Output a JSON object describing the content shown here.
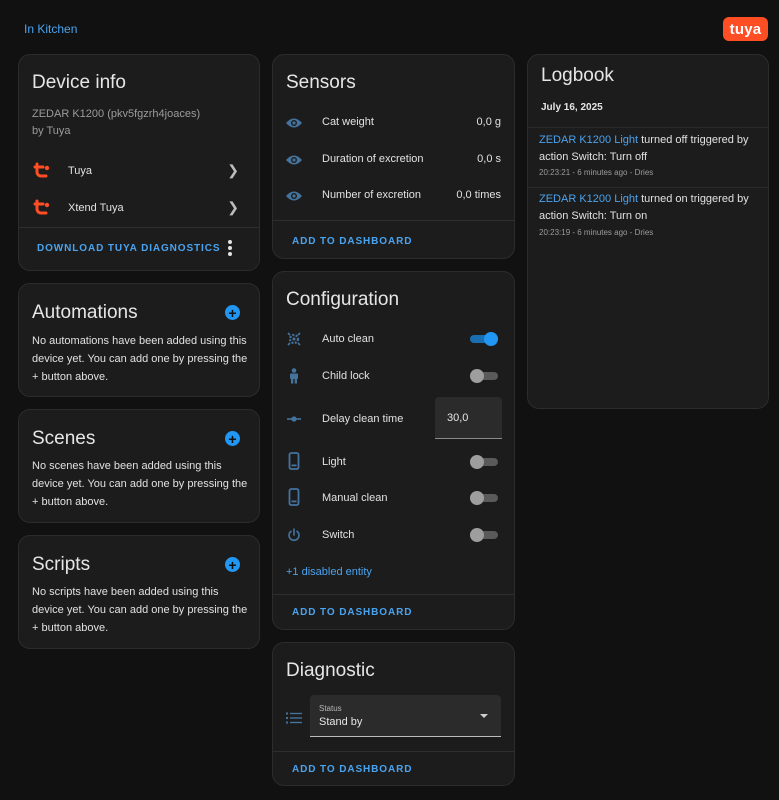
{
  "breadcrumb": {
    "area": "In Kitchen"
  },
  "logo": {
    "text": "tuya",
    "color": "#ff4d24"
  },
  "device_info": {
    "title": "Device info",
    "model": "ZEDAR K1200 (pkv5fgzrh4joaces)",
    "manufacturer": "by Tuya",
    "integrations": [
      {
        "label": "Tuya",
        "icon": "tuya-icon"
      },
      {
        "label": "Xtend Tuya",
        "icon": "tuya-icon"
      }
    ],
    "download_label": "DOWNLOAD TUYA DIAGNOSTICS"
  },
  "automations": {
    "title": "Automations",
    "text": "No automations have been added using this device yet. You can add one by pressing the + button above."
  },
  "scenes": {
    "title": "Scenes",
    "text": "No scenes have been added using this device yet. You can add one by pressing the + button above."
  },
  "scripts": {
    "title": "Scripts",
    "text": "No scripts have been added using this device yet. You can add one by pressing the + button above."
  },
  "sensors": {
    "title": "Sensors",
    "items": [
      {
        "name": "Cat weight",
        "value": "0,0 g",
        "icon": "eye-icon"
      },
      {
        "name": "Duration of excretion",
        "value": "0,0 s",
        "icon": "eye-icon"
      },
      {
        "name": "Number of excretion",
        "value": "0,0 times",
        "icon": "eye-icon"
      }
    ],
    "add_label": "ADD TO DASHBOARD"
  },
  "configuration": {
    "title": "Configuration",
    "items": [
      {
        "name": "Auto clean",
        "type": "toggle",
        "state": "on",
        "icon": "cog-sparkle-icon"
      },
      {
        "name": "Child lock",
        "type": "toggle",
        "state": "off",
        "icon": "child-icon"
      },
      {
        "name": "Delay clean time",
        "type": "number",
        "value": "30,0",
        "icon": "slider-icon"
      },
      {
        "name": "Light",
        "type": "toggle",
        "state": "off",
        "icon": "phone-icon"
      },
      {
        "name": "Manual clean",
        "type": "toggle",
        "state": "off",
        "icon": "phone-icon"
      },
      {
        "name": "Switch",
        "type": "toggle",
        "state": "off",
        "icon": "power-icon"
      }
    ],
    "disabled_link": "+1 disabled entity",
    "add_label": "ADD TO DASHBOARD"
  },
  "diagnostic": {
    "title": "Diagnostic",
    "select_label": "Status",
    "select_value": "Stand by",
    "add_label": "ADD TO DASHBOARD"
  },
  "logbook": {
    "title": "Logbook",
    "date": "July 16, 2025",
    "entries": [
      {
        "entity": "ZEDAR K1200 Light",
        "message": " turned off triggered by action Switch: Turn off",
        "meta": "20:23:21 - 6 minutes ago - Dries"
      },
      {
        "entity": "ZEDAR K1200 Light",
        "message": " turned on triggered by action Switch: Turn on",
        "meta": "20:23:19 - 6 minutes ago - Dries"
      }
    ]
  },
  "colors": {
    "accent": "#2196f3",
    "link": "#4aa3ef",
    "card": "#1c1c1c",
    "background": "#111111"
  }
}
